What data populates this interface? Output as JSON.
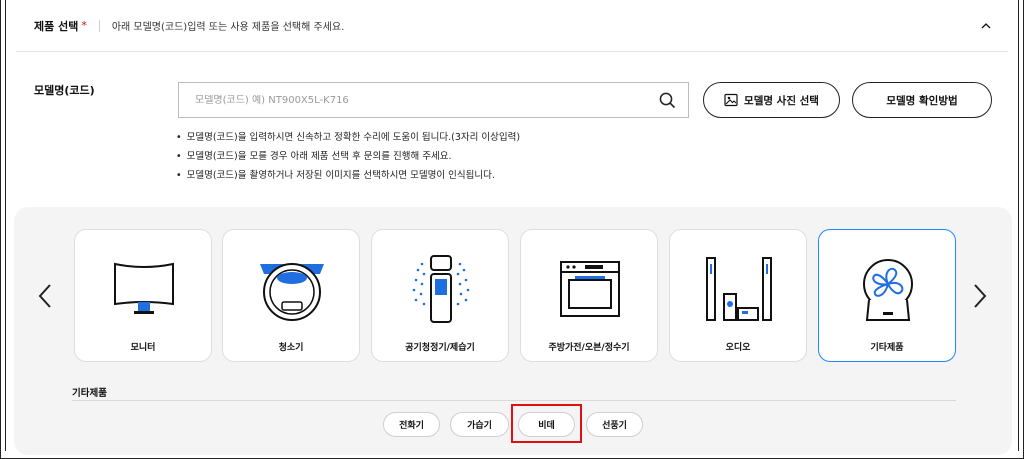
{
  "header": {
    "title": "제품 선택",
    "required_mark": "*",
    "description": "아래 모델명(코드)입력 또는 사용 제품을 선택해 주세요."
  },
  "model": {
    "label": "모델명(코드)",
    "search_placeholder": "모델명(코드) 예) NT900X5L-K716",
    "search_value": "",
    "photo_button": "모델명 사진 선택",
    "howto_button": "모델명 확인방법"
  },
  "notes": [
    "모델명(코드)을 입력하시면 신속하고 정확한 수리에 도움이 됩니다.(3자리 이상입력)",
    "모델명(코드)을 모를 경우 아래 제품 선택 후 문의를 진행해 주세요.",
    "모델명(코드)을 촬영하거나 저장된 이미지를 선택하시면 모델명이 인식됩니다."
  ],
  "categories": [
    {
      "label": "모니터",
      "icon": "monitor-icon"
    },
    {
      "label": "청소기",
      "icon": "robot-vacuum-icon"
    },
    {
      "label": "공기청정기/제습기",
      "icon": "air-purifier-icon"
    },
    {
      "label": "주방가전/오븐/정수기",
      "icon": "oven-icon"
    },
    {
      "label": "오디오",
      "icon": "speaker-system-icon"
    },
    {
      "label": "기타제품",
      "icon": "fan-icon"
    }
  ],
  "selected_category": "기타제품",
  "subcategory": {
    "title": "기타제품",
    "chips": [
      "전화기",
      "가습기",
      "비데",
      "선풍기"
    ]
  },
  "colors": {
    "selected_border": "#2189ff",
    "required": "#e0001b",
    "highlight": "#e01010",
    "icon_blue": "#1f6fe0"
  }
}
